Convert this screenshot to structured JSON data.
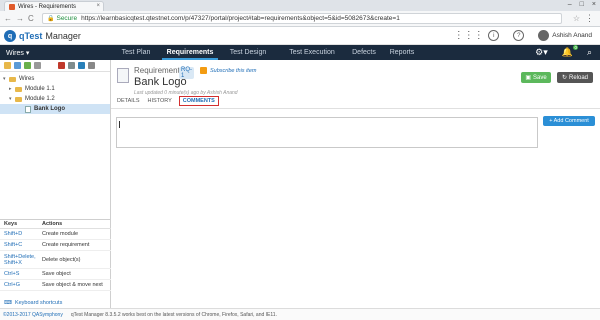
{
  "browser": {
    "tab_title": "Wires - Requirements",
    "tab_close": "×",
    "window_buttons": [
      "–",
      "□",
      "×"
    ],
    "secure_label": "Secure",
    "url": "https://learnbasicqtest.qtestnet.com/p/47327/portal/project#tab=requirements&object=5&id=5082673&create=1",
    "nav_back": "←",
    "nav_forward": "→",
    "nav_reload": "C",
    "star": "☆",
    "menu": "⋮"
  },
  "app": {
    "logo_mark": "q",
    "logo_q": "qTest",
    "logo_manager": "Manager",
    "user_name": "Ashish Anand",
    "project_selector": "Wires ▾",
    "notif_count": "0"
  },
  "nav": {
    "tabs": [
      "Test Plan",
      "Requirements",
      "Test Design",
      "Test Execution",
      "Defects",
      "Reports"
    ],
    "active": "Requirements"
  },
  "tree": {
    "root": "Wires",
    "module1": "Module 1.1",
    "module2": "Module 1.2",
    "selected": "Bank Logo"
  },
  "shortcuts": {
    "header_keys": "Keys",
    "header_actions": "Actions",
    "rows": [
      {
        "key": "Shift+D",
        "action": "Create module"
      },
      {
        "key": "Shift+C",
        "action": "Create requirement"
      },
      {
        "key": "Shift+Delete, Shift+X",
        "action": "Delete object(s)"
      },
      {
        "key": "Ctrl+S",
        "action": "Save object"
      },
      {
        "key": "Ctrl+G",
        "action": "Save object & move next"
      }
    ],
    "link": "Keyboard shortcuts"
  },
  "requirement": {
    "type": "Requirement",
    "id": "RQ-1",
    "subscribe": "Subscribe this item",
    "name": "Bank Logo",
    "meta": "Last updated 0 minute(s) ago by Ashish Anand",
    "save": "Save",
    "reload": "Reload"
  },
  "subtabs": {
    "details": "DETAILS",
    "history": "HISTORY",
    "comments": "COMMENTS"
  },
  "comments": {
    "add_button": "+ Add Comment"
  },
  "footer": {
    "copyright": "©2013-2017 QASymphony",
    "note": "qTest Manager 8.3.5.2 works best on the latest versions of Chrome, Firefox, Safari, and IE11."
  }
}
